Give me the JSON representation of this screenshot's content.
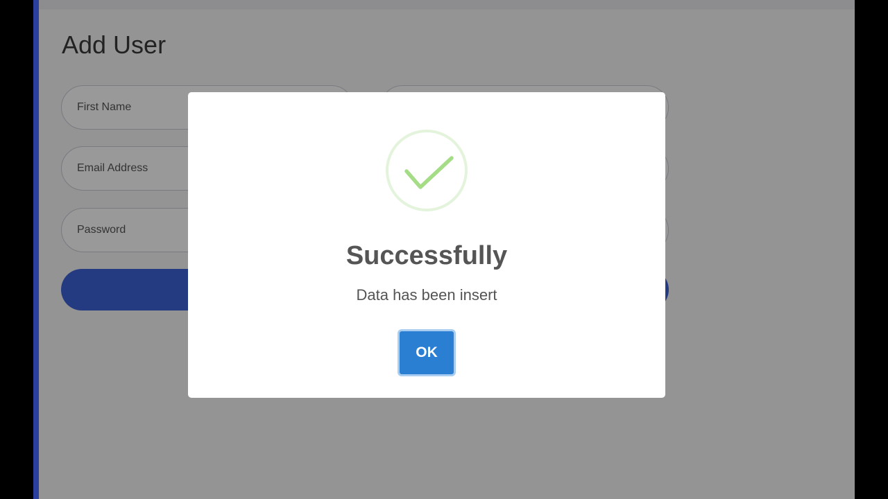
{
  "page": {
    "title": "Add User"
  },
  "form": {
    "first_name_placeholder": "First Name",
    "email_placeholder": "Email Address",
    "password_placeholder": "Password"
  },
  "dialog": {
    "icon": "checkmark-icon",
    "title": "Successfully",
    "message": "Data has been insert",
    "ok_label": "OK"
  },
  "colors": {
    "accent": "#2a3f9e",
    "submit_button": "#3f63d8",
    "ok_button": "#2b7fd3",
    "success_check": "#a5dc86"
  }
}
